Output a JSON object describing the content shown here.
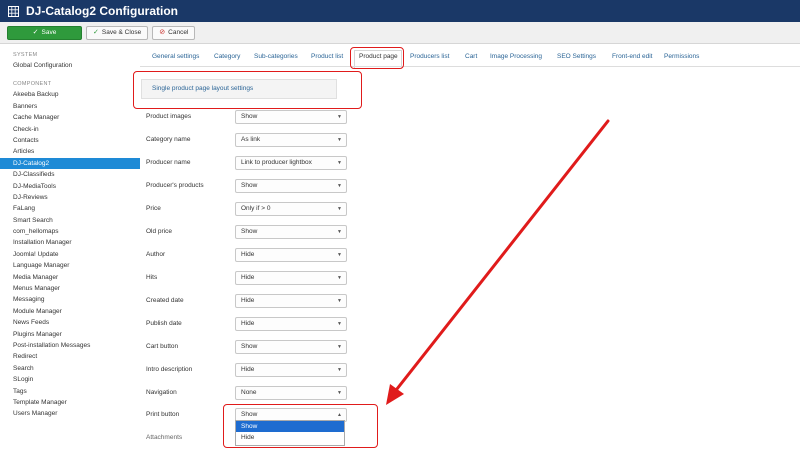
{
  "header": {
    "title": "DJ-Catalog2 Configuration"
  },
  "toolbar": {
    "save": "Save",
    "save_close": "Save & Close",
    "cancel": "Cancel"
  },
  "sidebar": {
    "system_header": "SYSTEM",
    "global_config": "Global Configuration",
    "component_header": "COMPONENT",
    "items": [
      "Akeeba Backup",
      "Banners",
      "Cache Manager",
      "Check-in",
      "Contacts",
      "Articles",
      "DJ-Catalog2",
      "DJ-Classifieds",
      "DJ-MediaTools",
      "DJ-Reviews",
      "FaLang",
      "Smart Search",
      "com_hellomaps",
      "Installation Manager",
      "Joomla! Update",
      "Language Manager",
      "Media Manager",
      "Menus Manager",
      "Messaging",
      "Module Manager",
      "News Feeds",
      "Plugins Manager",
      "Post-installation Messages",
      "Redirect",
      "Search",
      "SLogin",
      "Tags",
      "Template Manager",
      "Users Manager"
    ],
    "active_index": 6
  },
  "tabs": [
    "General settings",
    "Category",
    "Sub-categories",
    "Product list",
    "Product page",
    "Producers list",
    "Cart",
    "Image Processing",
    "SEO Settings",
    "Front-end edit",
    "Permissions"
  ],
  "active_tab": "Product page",
  "section": {
    "title": "Single product page layout settings"
  },
  "fields": [
    {
      "label": "Product images",
      "value": "Show"
    },
    {
      "label": "Category name",
      "value": "As link"
    },
    {
      "label": "Producer name",
      "value": "Link to producer lightbox"
    },
    {
      "label": "Producer's products",
      "value": "Show"
    },
    {
      "label": "Price",
      "value": "Only if > 0"
    },
    {
      "label": "Old price",
      "value": "Show"
    },
    {
      "label": "Author",
      "value": "Hide"
    },
    {
      "label": "Hits",
      "value": "Hide"
    },
    {
      "label": "Created date",
      "value": "Hide"
    },
    {
      "label": "Publish date",
      "value": "Hide"
    },
    {
      "label": "Cart button",
      "value": "Show"
    },
    {
      "label": "Intro description",
      "value": "Hide"
    },
    {
      "label": "Navigation",
      "value": "None"
    },
    {
      "label": "Print button",
      "value": "Show"
    }
  ],
  "partial_label": "Attachments",
  "dropdown": {
    "options": [
      "Show",
      "Hide"
    ],
    "highlighted": "Show"
  },
  "colors": {
    "topbar": "#1a3867",
    "save": "#2f9a3c",
    "active": "#1e8ad6",
    "annotation": "#e01b1b",
    "link": "#2a6496"
  }
}
